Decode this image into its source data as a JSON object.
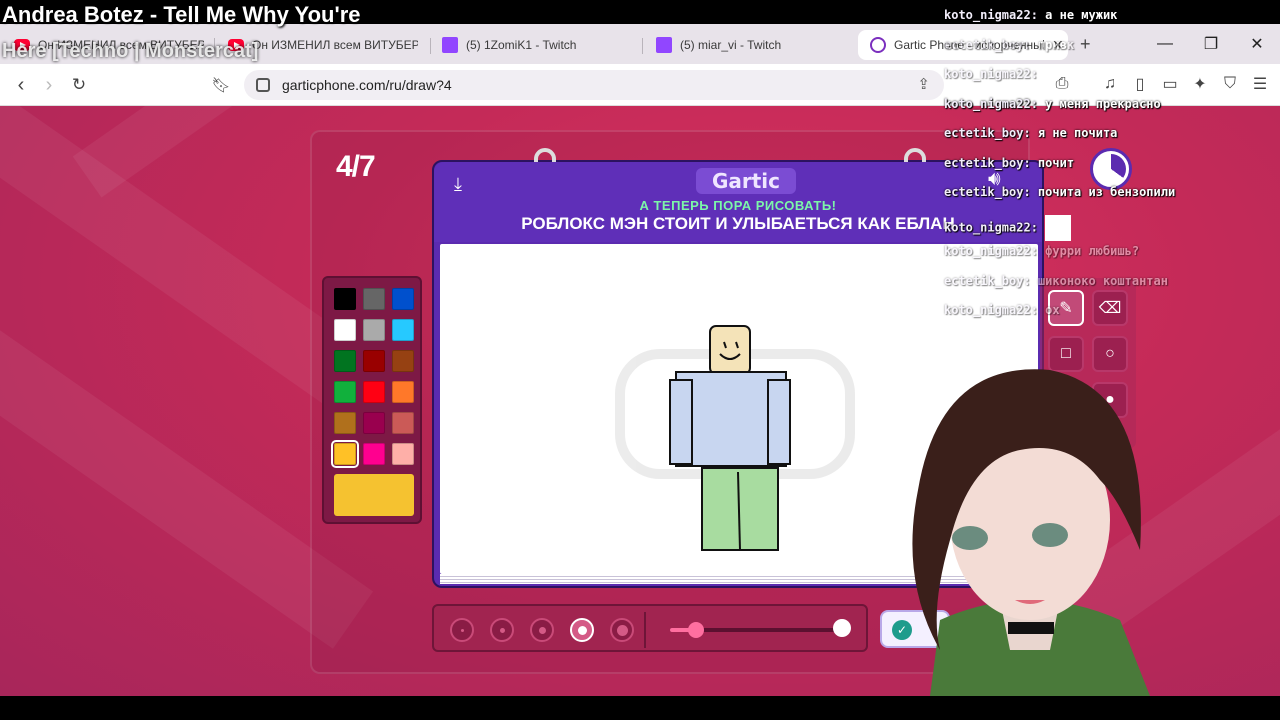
{
  "overlay": {
    "now_playing_line1": "Andrea Botez - Tell Me Why You're",
    "now_playing_line2": "Here [Techno | Monstercat]",
    "chat": [
      {
        "user": "koto_nigma22",
        "msg": "а не мужик",
        "faded": false
      },
      {
        "user": "ectetik_boy",
        "msg": "привк",
        "faded": true
      },
      {
        "user": "koto_nigma22",
        "msg": "",
        "faded": true
      },
      {
        "user": "koto_nigma22",
        "msg": "у меня прекрасно",
        "faded": false
      },
      {
        "user": "ectetik_boy",
        "msg": "я не почита",
        "faded": false
      },
      {
        "user": "ectetik_boy",
        "msg": "почит",
        "faded": false
      },
      {
        "user": "ectetik_boy",
        "msg": "почита из бензопили",
        "faded": false
      },
      {
        "user": "koto_nigma22",
        "msg": "",
        "faded": false
      },
      {
        "user": "koto_nigma22",
        "msg": "фурри любишь?",
        "faded": true
      },
      {
        "user": "ectetik_boy",
        "msg": "шиконоко коштантан",
        "faded": true
      },
      {
        "user": "koto_nigma22",
        "msg": "ох",
        "faded": true
      }
    ]
  },
  "browser": {
    "tabs": [
      {
        "label": "Он ИЗМЕНИЛ всем ВИТУБЕРАМ",
        "icon": "youtube-icon",
        "active": false
      },
      {
        "label": "Он ИЗМЕНИЛ всем ВИТУБЕРАМ",
        "icon": "youtube-icon",
        "active": false
      },
      {
        "label": "(5) 1ZomiK1 - Twitch",
        "icon": "twitch-icon",
        "active": false
      },
      {
        "label": "(5) miar_vi - Twitch",
        "icon": "twitch-icon",
        "active": false
      },
      {
        "label": "Gartic Phone - испорченный",
        "icon": "gartic-icon",
        "active": true
      }
    ],
    "url": "garticphone.com/ru/draw?4"
  },
  "game": {
    "round": "4/7",
    "logo": "Gartic",
    "subtitle": "А ТЕПЕРЬ ПОРА РИСОВАТЬ!",
    "prompt": "РОБЛОКС МЭН СТОИТ И УЛЫБАЕТЬСЯ КАК ЕБЛАН",
    "palette": [
      "#000000",
      "#666666",
      "#0050cd",
      "#ffffff",
      "#aaaaaa",
      "#26c9ff",
      "#017420",
      "#990000",
      "#964112",
      "#11b03c",
      "#ff0013",
      "#ff7829",
      "#b0701c",
      "#99004e",
      "#cb5a57",
      "#ffc126",
      "#ff008f",
      "#feafa8"
    ],
    "selected_color": "#f5c230",
    "brush_sizes": 5,
    "selected_brush_index": 3,
    "opacity_value": 0.15
  }
}
